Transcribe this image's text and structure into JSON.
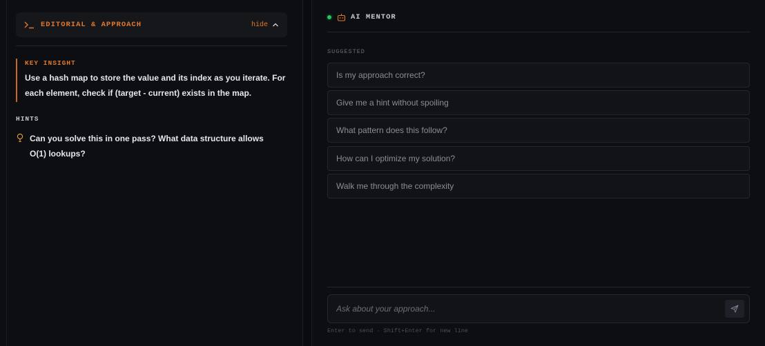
{
  "editorial": {
    "title": "EDITORIAL & APPROACH",
    "hide_label": "hide",
    "key_insight_label": "KEY INSIGHT",
    "key_insight_text": "Use a hash map to store the value and its index as you iterate. For each element, check if (target - current) exists in the map.",
    "hints_label": "HINTS",
    "hints": [
      "Can you solve this in one pass? What data structure allows O(1) lookups?"
    ]
  },
  "mentor": {
    "title": "AI MENTOR",
    "status": "online",
    "suggested_label": "SUGGESTED",
    "suggestions": [
      "Is my approach correct?",
      "Give me a hint without spoiling",
      "What pattern does this follow?",
      "How can I optimize my solution?",
      "Walk me through the complexity"
    ],
    "input": {
      "placeholder": "Ask about your approach...",
      "value": ""
    },
    "help_text": "Enter to send · Shift+Enter for new line"
  },
  "colors": {
    "accent": "#e0792c",
    "status_online": "#22c55e",
    "background": "#0d0e12"
  },
  "icons": {
    "editorial": "terminal-prompt-icon",
    "hide": "chevron-up-icon",
    "hint": "lightbulb-icon",
    "mentor": "bot-icon",
    "send": "send-icon"
  }
}
